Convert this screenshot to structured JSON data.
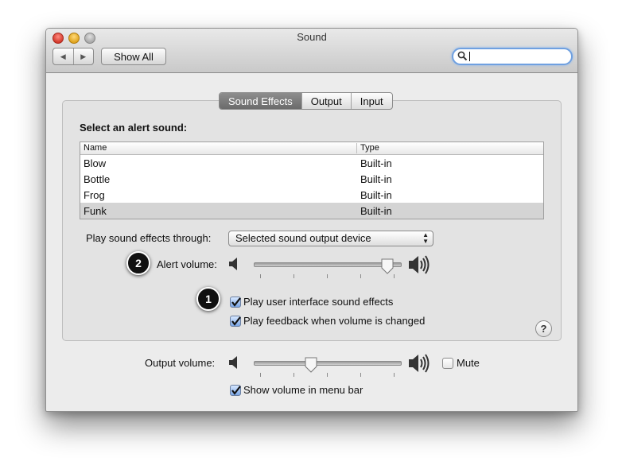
{
  "window": {
    "title": "Sound"
  },
  "toolbar": {
    "show_all_label": "Show All",
    "search": {
      "value": "",
      "placeholder": ""
    }
  },
  "tabs": [
    {
      "label": "Sound Effects",
      "selected": true
    },
    {
      "label": "Output",
      "selected": false
    },
    {
      "label": "Input",
      "selected": false
    }
  ],
  "sound_effects": {
    "select_label": "Select an alert sound:",
    "columns": [
      "Name",
      "Type"
    ],
    "rows": [
      {
        "name": "Blow",
        "type": "Built-in"
      },
      {
        "name": "Bottle",
        "type": "Built-in"
      },
      {
        "name": "Frog",
        "type": "Built-in"
      },
      {
        "name": "Funk",
        "type": "Built-in",
        "selected": true
      }
    ],
    "play_through_label": "Play sound effects through:",
    "play_through_value": "Selected sound output device",
    "alert_volume_label": "Alert volume:",
    "alert_volume_level": 0.95,
    "ui_sounds": {
      "label": "Play user interface sound effects",
      "checked": true
    },
    "feedback": {
      "label": "Play feedback when volume is changed",
      "checked": true
    },
    "help_label": "?"
  },
  "output": {
    "volume_label": "Output volume:",
    "volume_level": 0.38,
    "mute": {
      "label": "Mute",
      "checked": false
    },
    "show_in_menu": {
      "label": "Show volume in menu bar",
      "checked": true
    }
  },
  "annotations": [
    {
      "number": "1"
    },
    {
      "number": "2"
    }
  ],
  "colors": {
    "accent": "#6fa0e0",
    "checkbox": "#7aa6e6",
    "selected_tab": "#7a7a7a",
    "selected_row": "#d4d4d4"
  },
  "icons": [
    "back-icon",
    "forward-icon",
    "search-icon",
    "speaker-low-icon",
    "speaker-high-icon",
    "checkmark-icon",
    "help-icon"
  ]
}
